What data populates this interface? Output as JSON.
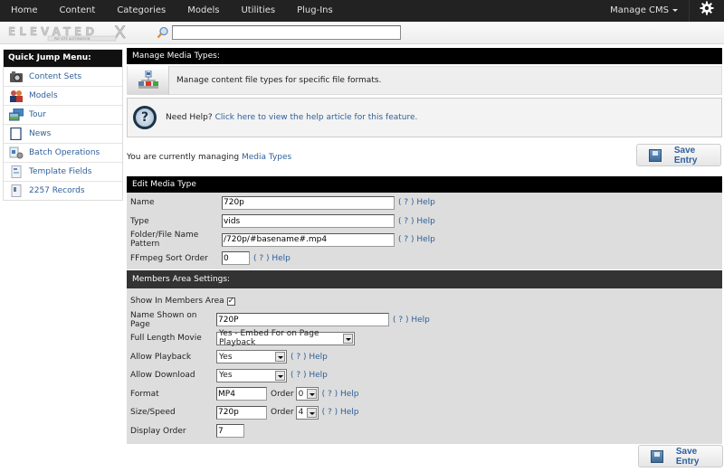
{
  "topnav": {
    "items": [
      "Home",
      "Content",
      "Categories",
      "Models",
      "Utilities",
      "Plug-Ins"
    ],
    "manage_label": "Manage CMS",
    "settings_icon": "gear-icon"
  },
  "subbar": {
    "logo_text": "ELEVATEDX",
    "logo_tagline": "PAY SITE AUTOMATION",
    "search_value": "",
    "search_placeholder": ""
  },
  "sidebar": {
    "title": "Quick Jump Menu:",
    "items": [
      {
        "label": "Content Sets",
        "icon": "camera-icon"
      },
      {
        "label": "Models",
        "icon": "people-icon"
      },
      {
        "label": "Tour",
        "icon": "images-icon"
      },
      {
        "label": "News",
        "icon": "document-icon"
      },
      {
        "label": "Batch Operations",
        "icon": "batch-gear-icon"
      },
      {
        "label": "Template Fields",
        "icon": "template-icon"
      },
      {
        "label": "2257 Records",
        "icon": "record-icon"
      }
    ]
  },
  "main": {
    "section_title": "Manage Media Types:",
    "description": "Manage content file types for specific file formats.",
    "help_prefix": "Need Help?",
    "help_link": "Click here to view the help article for this feature.",
    "managing_prefix": "You are currently managing",
    "managing_link": "Media Types",
    "save_label": "Save Entry",
    "edit_title": "Edit Media Type",
    "help_text": "( ? ) Help",
    "fields": {
      "name": {
        "label": "Name",
        "value": "720p"
      },
      "type": {
        "label": "Type",
        "value": "vids"
      },
      "pattern": {
        "label": "Folder/File Name Pattern",
        "value": "/720p/#basename#.mp4"
      },
      "ffmpeg": {
        "label": "FFmpeg Sort Order",
        "value": "0"
      }
    },
    "members_title": "Members Area Settings:",
    "members": {
      "show": {
        "label": "Show In Members Area",
        "checked": true,
        "mark": "✓"
      },
      "name_shown": {
        "label": "Name Shown on Page",
        "value": "720P"
      },
      "full_length": {
        "label": "Full Length Movie",
        "value": "Yes - Embed For on Page Playback"
      },
      "allow_playback": {
        "label": "Allow Playback",
        "value": "Yes"
      },
      "allow_download": {
        "label": "Allow Download",
        "value": "Yes"
      },
      "format": {
        "label": "Format",
        "value": "MP4",
        "order_label": "Order",
        "order_value": "0"
      },
      "size_speed": {
        "label": "Size/Speed",
        "value": "720p",
        "order_label": "Order",
        "order_value": "4"
      },
      "display_order": {
        "label": "Display Order",
        "value": "7"
      }
    }
  }
}
